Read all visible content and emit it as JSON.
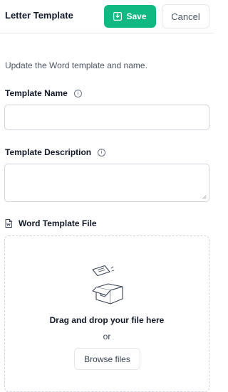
{
  "header": {
    "title": "Letter Template",
    "save_label": "Save",
    "cancel_label": "Cancel"
  },
  "form": {
    "subtitle": "Update the Word template and name.",
    "name_label": "Template Name",
    "name_value": "",
    "description_label": "Template Description",
    "description_value": "",
    "file_label": "Word Template File"
  },
  "upload": {
    "drop_text": "Drag and drop your file here",
    "or_text": "or",
    "browse_label": "Browse files"
  },
  "colors": {
    "accent": "#10b981",
    "border": "#d1d5db"
  },
  "icons": [
    "save-icon",
    "info-icon",
    "word-file-icon",
    "upload-box-icon",
    "resize-handle-icon"
  ]
}
